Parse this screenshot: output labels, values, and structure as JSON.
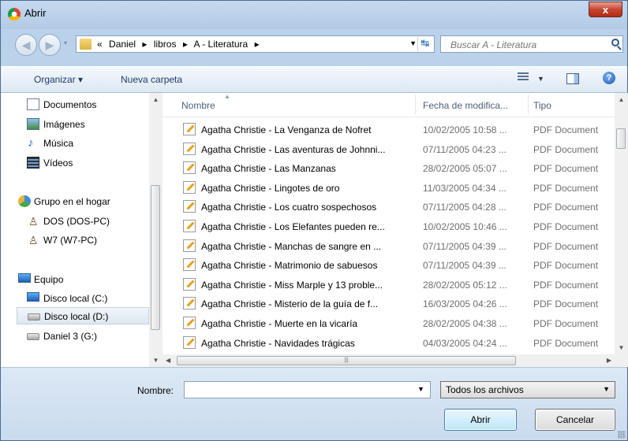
{
  "window": {
    "title": "Abrir",
    "close": "x"
  },
  "address": {
    "segments": [
      "«",
      "Daniel",
      "▸",
      "libros",
      "▸",
      "A - Literatura",
      "▸"
    ],
    "search_placeholder": "Buscar A - Literatura"
  },
  "toolbar": {
    "organize": "Organizar ▾",
    "new_folder": "Nueva carpeta",
    "help": "?"
  },
  "nav": {
    "items": [
      {
        "label": "Documentos",
        "icon": "documents-icon"
      },
      {
        "label": "Imágenes",
        "icon": "pictures-icon"
      },
      {
        "label": "Música",
        "icon": "music-icon"
      },
      {
        "label": "Vídeos",
        "icon": "videos-icon"
      },
      {
        "label": "Grupo en el hogar",
        "icon": "homegroup-icon"
      },
      {
        "label": "DOS (DOS-PC)",
        "icon": "user-pc-icon"
      },
      {
        "label": "W7 (W7-PC)",
        "icon": "user-pc-icon"
      },
      {
        "label": "Equipo",
        "icon": "computer-icon"
      },
      {
        "label": "Disco local (C:)",
        "icon": "system-drive-icon"
      },
      {
        "label": "Disco local (D:)",
        "icon": "drive-icon"
      },
      {
        "label": "Daniel 3 (G:)",
        "icon": "drive-icon"
      }
    ]
  },
  "columns": {
    "name": "Nombre",
    "date": "Fecha de modifica...",
    "type": "Tipo"
  },
  "files": [
    {
      "name": "Agatha Christie - La Venganza de Nofret",
      "date": "10/02/2005 10:58 ...",
      "type": "PDF Document"
    },
    {
      "name": "Agatha Christie - Las aventuras de Johnni...",
      "date": "07/11/2005 04:23 ...",
      "type": "PDF Document"
    },
    {
      "name": "Agatha Christie - Las Manzanas",
      "date": "28/02/2005 05:07 ...",
      "type": "PDF Document"
    },
    {
      "name": "Agatha Christie - Lingotes de oro",
      "date": "11/03/2005 04:34 ...",
      "type": "PDF Document"
    },
    {
      "name": "Agatha Christie - Los cuatro sospechosos",
      "date": "07/11/2005 04:28 ...",
      "type": "PDF Document"
    },
    {
      "name": "Agatha Christie - Los Elefantes pueden re...",
      "date": "10/02/2005 10:46 ...",
      "type": "PDF Document"
    },
    {
      "name": "Agatha Christie - Manchas de sangre en ...",
      "date": "07/11/2005 04:39 ...",
      "type": "PDF Document"
    },
    {
      "name": "Agatha Christie - Matrimonio de sabuesos",
      "date": "07/11/2005 04:39 ...",
      "type": "PDF Document"
    },
    {
      "name": "Agatha Christie - Miss Marple y 13 proble...",
      "date": "28/02/2005 05:12 ...",
      "type": "PDF Document"
    },
    {
      "name": "Agatha Christie - Misterio de la guía de f...",
      "date": "16/03/2005 04:26 ...",
      "type": "PDF Document"
    },
    {
      "name": "Agatha Christie - Muerte en la vicaría",
      "date": "28/02/2005 04:38 ...",
      "type": "PDF Document"
    },
    {
      "name": "Agatha Christie - Navidades trágicas",
      "date": "04/03/2005 04:24 ...",
      "type": "PDF Document"
    }
  ],
  "bottom": {
    "name_label": "Nombre:",
    "name_value": "",
    "filter": "Todos los archivos",
    "open": "Abrir",
    "cancel": "Cancelar"
  }
}
